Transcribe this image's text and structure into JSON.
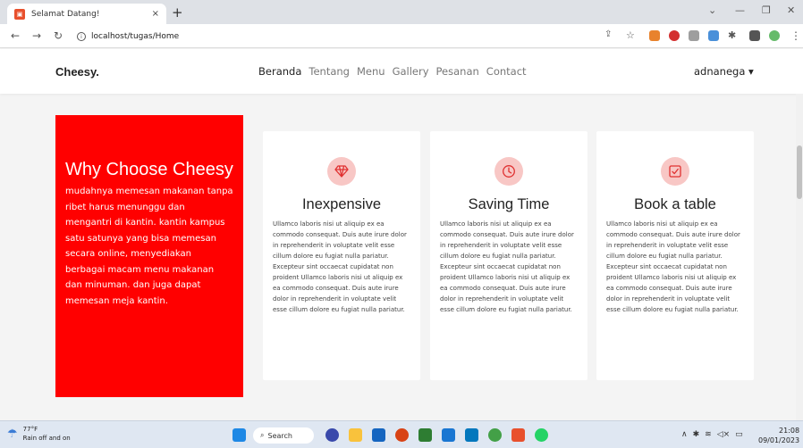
{
  "browser": {
    "tab_title": "Selamat Datang!",
    "tab_close": "×",
    "new_tab": "+",
    "url": "localhost/tugas/Home"
  },
  "site": {
    "logo": "Cheesy.",
    "menu": [
      "Beranda",
      "Tentang",
      "Menu",
      "Gallery",
      "Pesanan",
      "Contact"
    ],
    "user": "adnanega ▾"
  },
  "why": {
    "title": "Why Choose Cheesy",
    "body": "mudahnya memesan makanan tanpa ribet harus menunggu dan mengantri di kantin. kantin kampus satu satunya yang bisa memesan secara online, menyediakan berbagai macam menu makanan dan minuman. dan juga dapat memesan meja kantin."
  },
  "cards": [
    {
      "icon": "diamond-icon",
      "title": "Inexpensive",
      "body": "Ullamco laboris nisi ut aliquip ex ea commodo consequat. Duis aute irure dolor in reprehenderit in voluptate velit esse cillum dolore eu fugiat nulla pariatur. Excepteur sint occaecat cupidatat non proident Ullamco laboris nisi ut aliquip ex ea commodo consequat. Duis aute irure dolor in reprehenderit in voluptate velit esse cillum dolore eu fugiat nulla pariatur."
    },
    {
      "icon": "clock-icon",
      "title": "Saving Time",
      "body": "Ullamco laboris nisi ut aliquip ex ea commodo consequat. Duis aute irure dolor in reprehenderit in voluptate velit esse cillum dolore eu fugiat nulla pariatur. Excepteur sint occaecat cupidatat non proident Ullamco laboris nisi ut aliquip ex ea commodo consequat. Duis aute irure dolor in reprehenderit in voluptate velit esse cillum dolore eu fugiat nulla pariatur."
    },
    {
      "icon": "checkbox-icon",
      "title": "Book a table",
      "body": "Ullamco laboris nisi ut aliquip ex ea commodo consequat. Duis aute irure dolor in reprehenderit in voluptate velit esse cillum dolore eu fugiat nulla pariatur. Excepteur sint occaecat cupidatat non proident Ullamco laboris nisi ut aliquip ex ea commodo consequat. Duis aute irure dolor in reprehenderit in voluptate velit esse cillum dolore eu fugiat nulla pariatur."
    }
  ],
  "taskbar": {
    "temperature": "77°F",
    "weather": "Rain off and on",
    "search": "Search",
    "time": "21:08",
    "date": "09/01/2023"
  },
  "colors": {
    "accent": "#ff0000",
    "icon_bg": "#f8c7c5",
    "icon_stroke": "#e03131"
  }
}
